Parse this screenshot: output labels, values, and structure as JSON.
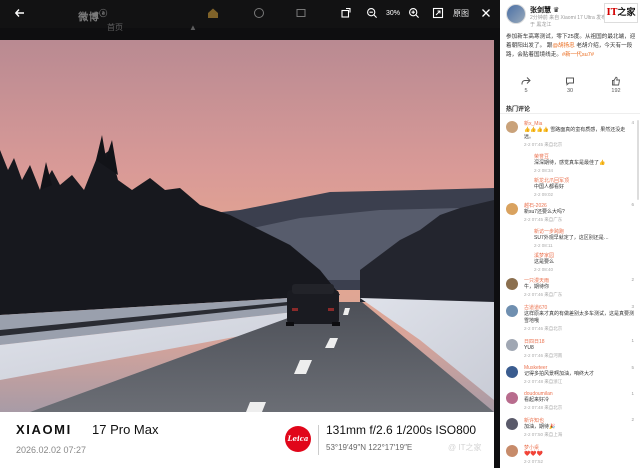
{
  "toolbar": {
    "brand_text": "微博",
    "brand_sub": "ⓐ",
    "ghost_tab_home": "首页",
    "ghost_tab_2": "▲",
    "zoom_level": "30%",
    "original_label": "原图"
  },
  "photo_caption": {
    "brand": "XIAOMI",
    "model": "17 Pro Max",
    "date": "2026.02.02  07:27",
    "leica": "Leica",
    "params": "131mm  f/2.6  1/200s  ISO800",
    "gps": "53°19′49″N  122°17′19″E"
  },
  "watermark": "@ IT之家",
  "post": {
    "user": "张剑慧 ♛",
    "meta": "2分钟前 来自 Xiaomi 17 Ultra 发布于 黑龙江",
    "text_before": "参加新车高寒测试，零下25度。从祖国的最北端，迎着朝阳出发了。 跟",
    "text_mention": "@胡扬忠",
    "text_after": " 老胡介绍，今天有一段路，会贴着国境线走。",
    "text_tag": "#新一代su7#",
    "share_count": "5",
    "comment_count": "30",
    "like_count": "192"
  },
  "hot_comments_title": "热门评论",
  "ithome": {
    "it": "IT",
    "home": "之家"
  },
  "comments": [
    {
      "name": "新x_Mia",
      "text": "👍👍👍👍 雪路面真的蛮有质感，果然还没走远。",
      "meta": "2-2 07:45 来自北京",
      "likes": "4",
      "color": "#c9a27a",
      "replies": [
        {
          "name": "荣誉豆",
          "text": "深深期待，感觉真车是最佳了👍",
          "meta": "2-2 08:34"
        },
        {
          "name": "新龙北爪回军顶",
          "text": "中国人都看好",
          "meta": "2-2 09:02"
        }
      ]
    },
    {
      "name": "越石-2026",
      "text": "新su7还要么大吗?",
      "meta": "2-2 07:45 来自广东",
      "likes": "6",
      "color": "#d9a25f",
      "replies": [
        {
          "name": "新访一步跨跑",
          "text": "SU7外观早就定了，这区别还是…",
          "meta": "2-2 08:11"
        },
        {
          "name": "溪梦家园",
          "text": "这是要么",
          "meta": "2-2 08:40"
        }
      ]
    },
    {
      "name": "一只漫天雨",
      "text": "牛，期待你",
      "meta": "2-2 07:46 来自广东",
      "likes": "2",
      "color": "#8b6f4e",
      "replies": []
    },
    {
      "name": "古道道670",
      "text": "这样原来才真的有做差别太多车测试，这是真要测雪地哦",
      "meta": "2-2 07:46 来自北京",
      "likes": "3",
      "color": "#6f8fb0",
      "replies": []
    },
    {
      "name": "日四日18",
      "text": "YU8",
      "meta": "2-2 07:46 来自河南",
      "likes": "1",
      "color": "#a0a7b3",
      "replies": []
    },
    {
      "name": "Musketeer",
      "text": "记得多拍风景啊加油，咱终大才",
      "meta": "2-2 07:48 来自浙江",
      "likes": "5",
      "color": "#3a5c8f",
      "replies": []
    },
    {
      "name": "doudoumilan",
      "text": "看起来好冷",
      "meta": "2-2 07:48 来自北京",
      "likes": "1",
      "color": "#b86c8d",
      "replies": []
    },
    {
      "name": "新许知也",
      "text": "加油，期待🎉",
      "meta": "2-2 07:50 来自上海",
      "likes": "2",
      "color": "#5a5a6a",
      "replies": []
    },
    {
      "name": "梦小桌",
      "text": "❤️❤️❤️",
      "meta": "2-2 07:52",
      "likes": "",
      "color": "#c78b6a",
      "replies": []
    }
  ]
}
